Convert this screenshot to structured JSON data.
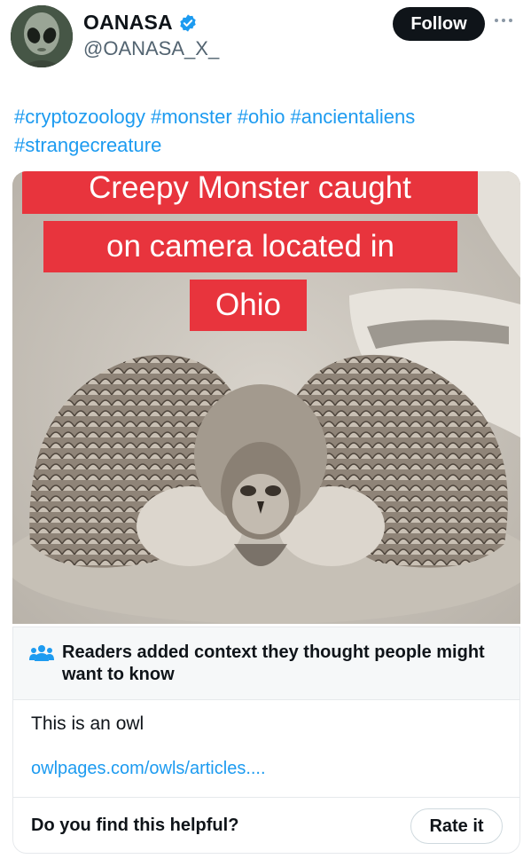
{
  "author": {
    "display_name": "OANASA",
    "handle": "@OANASA_X_",
    "verified_color": "#1d9bf0"
  },
  "header": {
    "follow_label": "Follow",
    "more_icon": "more-horizontal-icon"
  },
  "post": {
    "hashtags": [
      "#cryptozoology",
      "#monster",
      "#ohio",
      "#ancientaliens",
      "#strangecreature"
    ],
    "hashtag_color": "#1d9bf0"
  },
  "media": {
    "caption_lines": [
      "Creepy Monster caught",
      "on camera located in",
      "Ohio"
    ],
    "caption_bg": "#e8343d"
  },
  "community_note": {
    "icon": "people-icon",
    "title": "Readers added context they thought people might want to know",
    "body": "This is an owl",
    "link": "owlpages.com/owls/articles....",
    "question": "Do you find this helpful?",
    "rate_label": "Rate it"
  }
}
